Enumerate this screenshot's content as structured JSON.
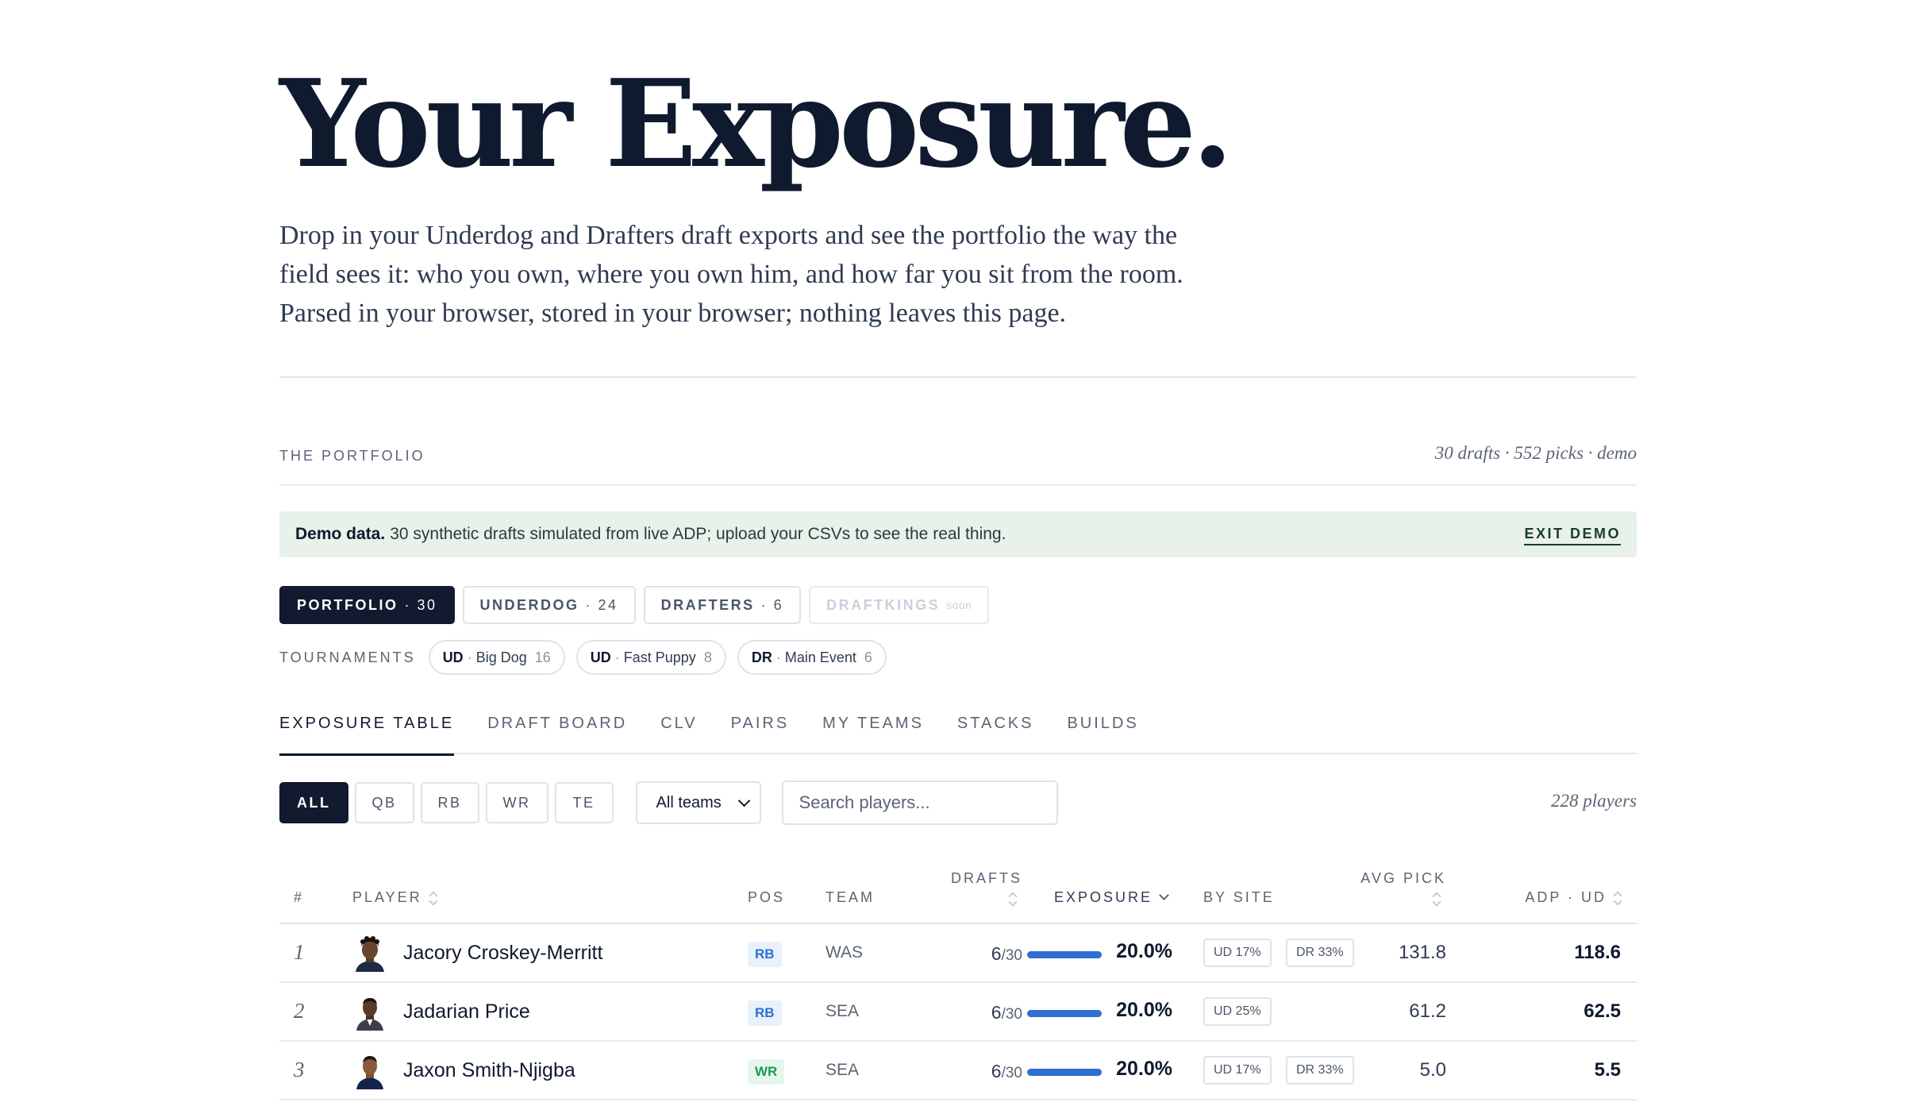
{
  "hero": {
    "title": "Your Exposure.",
    "description": "Drop in your Underdog and Drafters draft exports and see the portfolio the way the field sees it: who you own, where you own him, and how far you sit from the room. Parsed in your browser, stored in your browser; nothing leaves this page."
  },
  "section": {
    "label": "THE PORTFOLIO",
    "meta": "30 drafts · 552 picks · demo"
  },
  "demo_banner": {
    "strong": "Demo data.",
    "text": "30 synthetic drafts simulated from live ADP; upload your CSVs to see the real thing.",
    "exit_label": "EXIT DEMO"
  },
  "source_tabs": [
    {
      "label": "PORTFOLIO",
      "count": "· 30",
      "active": true
    },
    {
      "label": "UNDERDOG",
      "count": "· 24",
      "active": false
    },
    {
      "label": "DRAFTERS",
      "count": "· 6",
      "active": false
    },
    {
      "label": "DRAFTKINGS",
      "soon": "soon",
      "disabled": true
    }
  ],
  "tournaments": {
    "label": "TOURNAMENTS",
    "items": [
      {
        "site": "UD",
        "dot": "·",
        "name": "Big Dog",
        "count": "16"
      },
      {
        "site": "UD",
        "dot": "·",
        "name": "Fast Puppy",
        "count": "8"
      },
      {
        "site": "DR",
        "dot": "·",
        "name": "Main Event",
        "count": "6"
      }
    ]
  },
  "view_tabs": [
    "EXPOSURE TABLE",
    "DRAFT BOARD",
    "CLV",
    "PAIRS",
    "MY TEAMS",
    "STACKS",
    "BUILDS"
  ],
  "filters": {
    "positions": [
      "ALL",
      "QB",
      "RB",
      "WR",
      "TE"
    ],
    "active_position": "ALL",
    "team_select": "All teams",
    "search_placeholder": "Search players...",
    "player_count": "228 players"
  },
  "table": {
    "headers": {
      "rank": "#",
      "player": "PLAYER",
      "pos": "POS",
      "team": "TEAM",
      "drafts": "DRAFTS",
      "exposure": "EXPOSURE",
      "by_site": "BY SITE",
      "avg_pick": "AVG PICK",
      "adp": "ADP · UD"
    },
    "rows": [
      {
        "rank": "1",
        "name": "Jacory Croskey-Merritt",
        "pos": "RB",
        "team": "WAS",
        "drafts": "6",
        "drafts_total": "/30",
        "exposure": "20.0%",
        "exposure_value": 20.0,
        "sites": [
          "UD 17%",
          "DR 33%"
        ],
        "avg_pick": "131.8",
        "adp": "118.6"
      },
      {
        "rank": "2",
        "name": "Jadarian Price",
        "pos": "RB",
        "team": "SEA",
        "drafts": "6",
        "drafts_total": "/30",
        "exposure": "20.0%",
        "exposure_value": 20.0,
        "sites": [
          "UD 25%"
        ],
        "avg_pick": "61.2",
        "adp": "62.5"
      },
      {
        "rank": "3",
        "name": "Jaxon Smith-Njigba",
        "pos": "WR",
        "team": "SEA",
        "drafts": "6",
        "drafts_total": "/30",
        "exposure": "20.0%",
        "exposure_value": 20.0,
        "sites": [
          "UD 17%",
          "DR 33%"
        ],
        "avg_pick": "5.0",
        "adp": "5.5"
      }
    ]
  },
  "colors": {
    "ink": "#0f1a2e",
    "accent_blue": "#2f6fd1",
    "rb_badge_bg": "#e8f1fb",
    "wr_badge": "#1f9a52",
    "demo_banner_bg": "#e8f1ea"
  }
}
